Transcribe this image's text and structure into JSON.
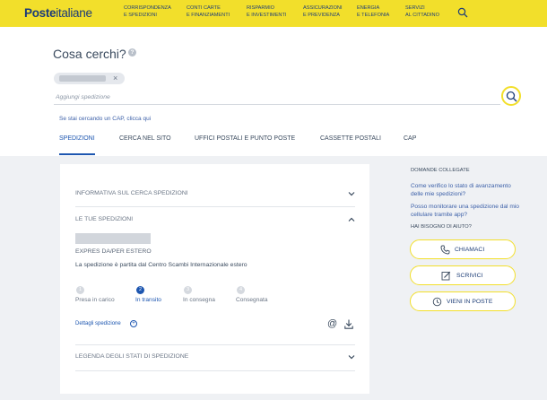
{
  "brand": {
    "bold": "Poste",
    "light": "italiane"
  },
  "nav": [
    {
      "line1": "Corrispondenza",
      "line2": "e spedizioni"
    },
    {
      "line1": "Conti carte",
      "line2": "e finanziamenti"
    },
    {
      "line1": "Risparmio",
      "line2": "e investimenti"
    },
    {
      "line1": "Assicurazioni",
      "line2": "e previdenza"
    },
    {
      "line1": "Energia",
      "line2": "e telefonia"
    },
    {
      "line1": "Servizi",
      "line2": "al cittadino"
    }
  ],
  "search": {
    "title": "Cosa cerchi?",
    "help": "?",
    "chip_close": "×",
    "placeholder": "Aggiungi spedizione",
    "cap_link": "Se stai cercando un CAP, clicca qui"
  },
  "tabs": [
    "Spedizioni",
    "Cerca nel sito",
    "Uffici postali e punto poste",
    "Cassette postali",
    "CAP"
  ],
  "accordion": {
    "info": "Informativa sul cerca spedizioni",
    "mine": "Le tue spedizioni",
    "legend": "Legenda degli stati di spedizione"
  },
  "shipment": {
    "type": "Expres da/per estero",
    "status": "La spedizione è partita dal Centro Scambi Internazionale estero",
    "steps": [
      {
        "num": "1",
        "label": "Presa in carico"
      },
      {
        "num": "2",
        "label": "In transito"
      },
      {
        "num": "3",
        "label": "In consegna"
      },
      {
        "num": "4",
        "label": "Consegnata"
      }
    ],
    "details": "Dettagli spedizione",
    "plus": "+",
    "at": "@"
  },
  "sidebar": {
    "related_title": "Domande collegate",
    "q1": "Come verifico lo stato di avanzamento delle mie spedizioni?",
    "q2": "Posso monitorare una spedizione dal mio cellulare tramite app?",
    "help_title": "Hai bisogno di aiuto?",
    "btn_call": "Chiamaci",
    "btn_write": "Scrivici",
    "btn_visit": "Vieni in poste"
  },
  "colors": {
    "brand_yellow": "#f2df2b",
    "brand_blue": "#1d56b0"
  }
}
